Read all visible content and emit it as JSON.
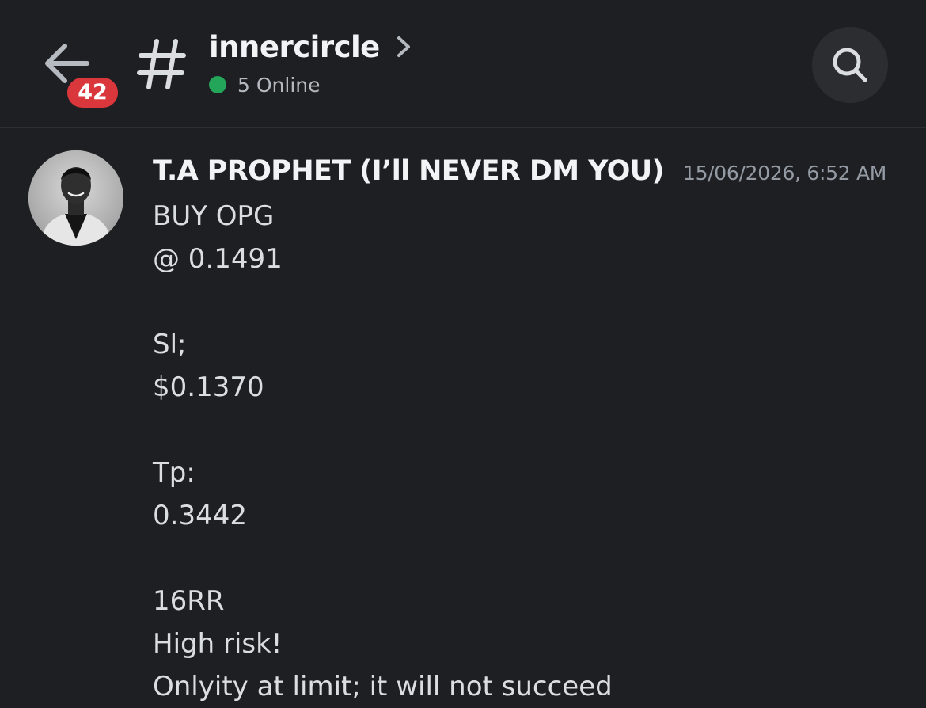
{
  "header": {
    "unread_count": "42",
    "channel_name": "innercircle",
    "online_text": "5 Online",
    "icons": {
      "back": "arrow-left-icon",
      "channel": "hash-icon",
      "expand": "chevron-right-icon",
      "search": "search-icon"
    }
  },
  "message": {
    "author": "T.A PROPHET (I’ll NEVER DM YOU)",
    "timestamp": "15/06/2026, 6:52 AM",
    "lines": [
      "BUY OPG",
      "@ 0.1491",
      "",
      "Sl;",
      "$0.1370",
      "",
      "Tp:",
      "0.3442",
      "",
      "16RR",
      "High risk!",
      "Onlyity at limit; it will not succeed"
    ]
  },
  "colors": {
    "background": "#1e1f22",
    "badge": "#da373c",
    "online": "#23a55a",
    "text": "#dbdee1",
    "muted": "#949ba4"
  }
}
